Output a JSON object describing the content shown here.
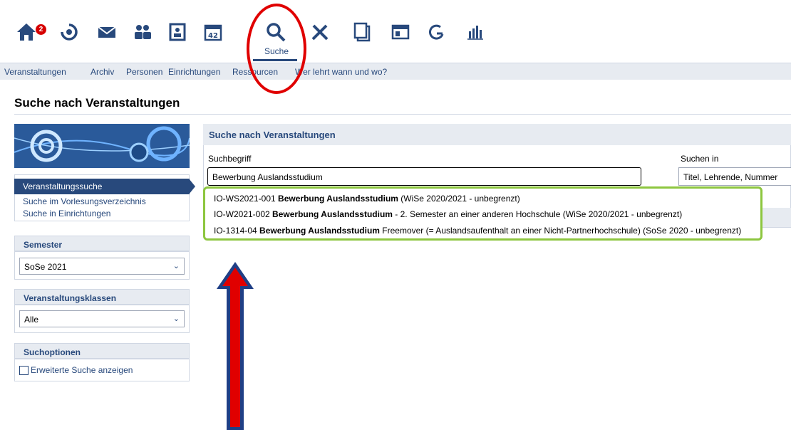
{
  "topbar": {
    "badge_count": "2",
    "active_label": "Suche",
    "icons": [
      "home-icon",
      "activity-icon",
      "mail-icon",
      "community-icon",
      "profile-icon",
      "calendar-icon",
      "search-icon",
      "tools-icon",
      "files-icon",
      "courses-icon",
      "statistics-icon",
      "chart-icon"
    ]
  },
  "subnav": {
    "items": [
      "Veranstaltungen",
      "Archiv",
      "Personen",
      "Einrichtungen",
      "Ressourcen",
      "Wer lehrt wann und wo?"
    ]
  },
  "page": {
    "title": "Suche nach Veranstaltungen"
  },
  "sidebar": {
    "active_item": "Veranstaltungssuche",
    "links": [
      "Suche im Vorlesungsverzeichnis",
      "Suche in Einrichtungen"
    ],
    "semester_head": "Semester",
    "semester_value": "SoSe 2021",
    "classes_head": "Veranstaltungsklassen",
    "classes_value": "Alle",
    "options_head": "Suchoptionen",
    "extended_label": "Erweiterte Suche anzeigen"
  },
  "search": {
    "panel_title": "Suche nach Veranstaltungen",
    "term_label": "Suchbegriff",
    "term_value": "Bewerbung Auslandsstudium",
    "scope_label": "Suchen in",
    "scope_value": "Titel, Lehrende, Nummer"
  },
  "suggestions": [
    {
      "code": "IO-WS2021-001 ",
      "title": "Bewerbung Auslandsstudium",
      "rest": " (WiSe 2020/2021 - unbegrenzt)"
    },
    {
      "code": "IO-W2021-002 ",
      "title": "Bewerbung Auslandsstudium",
      "rest": " - 2. Semester an einer anderen Hochschule (WiSe 2020/2021 - unbegrenzt)"
    },
    {
      "code": "IO-1314-04 ",
      "title": "Bewerbung Auslandsstudium",
      "rest": " Freemover (= Auslandsaufenthalt an einer Nicht-Partnerhochschule) (SoSe 2020 - unbegrenzt)"
    }
  ],
  "colors": {
    "brand": "#28497c",
    "highlight_box": "#8dc63f",
    "annotation": "#e00000"
  }
}
